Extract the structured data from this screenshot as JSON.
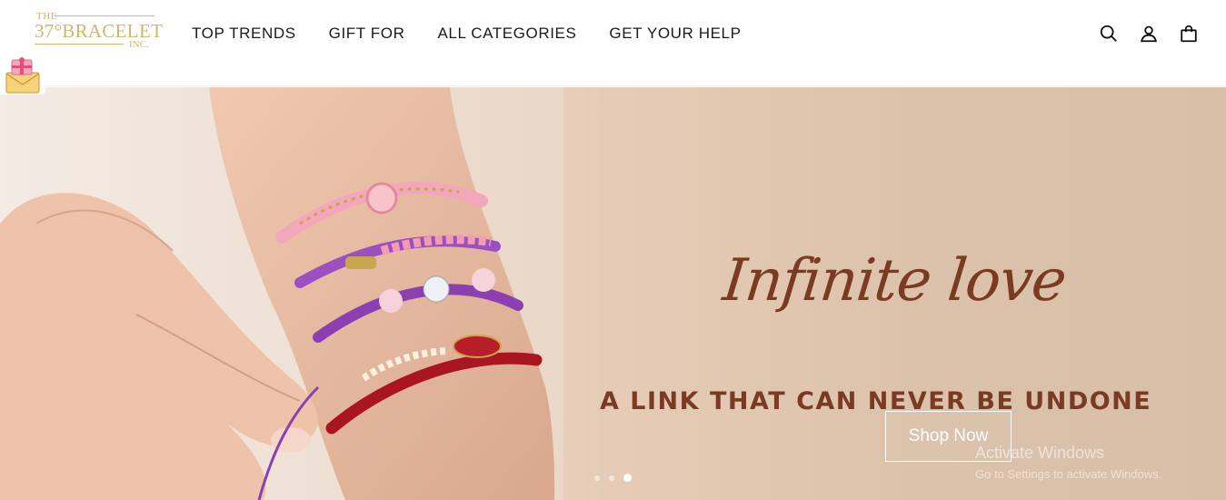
{
  "brand": {
    "logo_top": "THE",
    "logo_main": "37°BRACELET",
    "logo_bottom": "INC.",
    "gold": "#d4b468"
  },
  "nav": {
    "items": [
      {
        "label": "TOP TRENDS"
      },
      {
        "label": "GIFT FOR"
      },
      {
        "label": "ALL CATEGORIES"
      },
      {
        "label": "GET YOUR HELP"
      }
    ]
  },
  "header_icons": [
    "search-icon",
    "account-icon",
    "cart-bag-icon"
  ],
  "gift_badge_icon": "gift-envelope-icon",
  "hero": {
    "script_title": "Infinite love",
    "subtitle": "A LINK THAT CAN NEVER BE UNDONE",
    "cta_label": "Shop Now",
    "text_color": "#7a3b22",
    "slides": {
      "count": 3,
      "active_index": 3
    }
  },
  "overlay": {
    "title": "Activate Windows",
    "subtitle": "Go to Settings to activate Windows."
  }
}
